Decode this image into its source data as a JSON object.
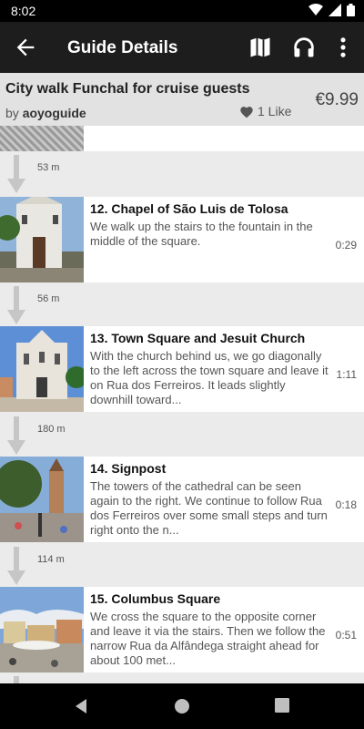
{
  "status": {
    "time": "8:02"
  },
  "appbar": {
    "title": "Guide Details",
    "back_icon": "arrow-left-icon",
    "actions": [
      "map-icon",
      "headphones-icon",
      "more-vert-icon"
    ]
  },
  "guide": {
    "title": "City walk Funchal for cruise guests",
    "by_label": "by",
    "author": "aoyoguide",
    "likes": "1 Like",
    "price": "€9.99"
  },
  "distances": [
    "53 m",
    "56 m",
    "180 m",
    "114 m"
  ],
  "stops": [
    {
      "name": "12. Chapel of São Luis de Tolosa",
      "desc": "We walk up the stairs to the fountain in the middle of the square.",
      "duration": "0:29"
    },
    {
      "name": "13. Town Square and Jesuit Church",
      "desc": "With the church behind us, we go diagonally to the left across the town square and leave it on Rua dos Ferreiros. It leads slightly downhill toward...",
      "duration": "1:11"
    },
    {
      "name": "14. Signpost",
      "desc": "The towers of the cathedral can be seen again to the right. We continue to follow Rua dos Ferreiros over some small steps and turn right onto the n...",
      "duration": "0:18"
    },
    {
      "name": "15. Columbus Square",
      "desc": "We cross the square to the opposite corner and leave it via the stairs. Then we follow the narrow Rua da Alfândega straight ahead for about 100 met...",
      "duration": "0:51"
    }
  ]
}
